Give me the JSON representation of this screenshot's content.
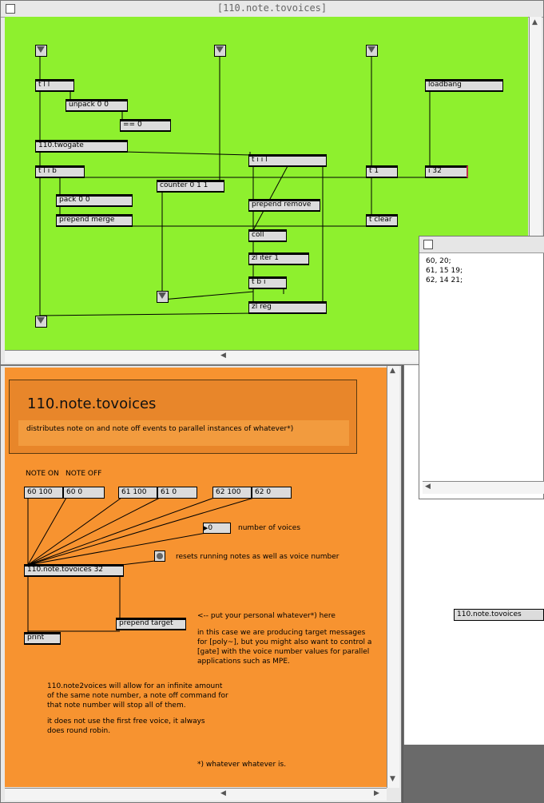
{
  "window_top": {
    "title": "[110.note.tovoices]",
    "objects": {
      "t_l_l": "t l l",
      "unpack": "unpack 0 0",
      "eq0": "== 0",
      "twogate": "110.twogate",
      "t_l_i_b": "t l i b",
      "pack": "pack 0 0",
      "prepend_merge": "prepend merge",
      "counter": "counter 0 1 1",
      "t_i_i_l": "t i i l",
      "prepend_remove": "prepend remove",
      "coll": "coll",
      "zl_iter": "zl iter 1",
      "t_b_i": "t b i",
      "zl_reg": "zl reg",
      "t_1": "t 1",
      "t_clear": "t clear",
      "loadbang": "loadbang",
      "i_32": "i 32"
    }
  },
  "coll_window": {
    "lines": [
      "60, 20;",
      "61, 15 19;",
      "62, 14 21;"
    ]
  },
  "helper_object": "110.note.tovoices",
  "window_help": {
    "title": "110.note.tovoices",
    "subtitle": "distributes note on and note off events to parallel instances of whatever*)",
    "note_on_label": "NOTE ON",
    "note_off_label": "NOTE OFF",
    "messages": [
      "60 100",
      "60 0",
      "61 100",
      "61 0",
      "62 100",
      "62 0"
    ],
    "number_box": "0",
    "number_of_voices_label": "number of voices",
    "reset_label": "resets running notes as well as voice number",
    "main_object": "110.note.tovoices 32",
    "prepend_target": "prepend target",
    "print": "print",
    "put_here": "<-- put your personal whatever*) here",
    "para1": [
      "in this case we are producing target messages",
      "for [poly~], but you might also want to control a",
      "[gate] with the voice number values for parallel",
      "applications such as MPE."
    ],
    "para2": [
      "110.note2voices will allow for an infinite amount",
      "of the same note number, a note off command for",
      "that note number will stop all of them."
    ],
    "para3": [
      "it does not use the first free voice, it always",
      "does round robin."
    ],
    "footnote": "*) whatever whatever is."
  }
}
